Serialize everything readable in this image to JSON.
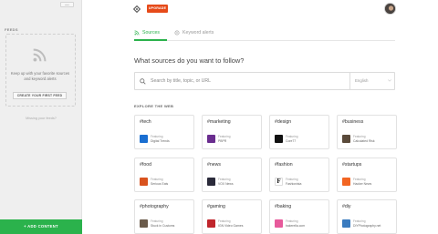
{
  "sidebar": {
    "collapse_label": "«««",
    "feeds_title": "FEEDS",
    "empty_message": "Keep up with your favorite sources and keyword alerts",
    "create_button": "CREATE YOUR FIRST FEED",
    "missing_feeds": "Missing your feeds?",
    "add_content": "+ ADD CONTENT",
    "rss_icon": "rss-icon"
  },
  "topbar": {
    "upgrade_label": "UPGRADE",
    "logo_icon": "feedly-logo-icon",
    "avatar_icon": "user-avatar"
  },
  "tabs": [
    {
      "label": "Sources",
      "icon": "rss-icon",
      "active": true
    },
    {
      "label": "Keyword alerts",
      "icon": "alert-icon",
      "active": false
    }
  ],
  "main": {
    "question": "What sources do you want to follow?",
    "search_placeholder": "Search by title, topic, or URL",
    "language": "English",
    "explore_title": "EXPLORE THE WEB"
  },
  "cards": [
    {
      "tag": "#tech",
      "featuring": "Featuring",
      "source": "Digital Trends",
      "color": "#1a6fd1"
    },
    {
      "tag": "#marketing",
      "featuring": "Featuring",
      "source": "PBPR",
      "color": "#6a2d8f"
    },
    {
      "tag": "#design",
      "featuring": "Featuring",
      "source": "Core77",
      "color": "#111111"
    },
    {
      "tag": "#business",
      "featuring": "Featuring",
      "source": "Calculated Risk",
      "color": "#5a4a3a"
    },
    {
      "tag": "#food",
      "featuring": "Featuring",
      "source": "Serious Eats",
      "color": "#d9531e"
    },
    {
      "tag": "#news",
      "featuring": "Featuring",
      "source": "VOX News",
      "color": "#2a2a3a"
    },
    {
      "tag": "#fashion",
      "featuring": "Featuring",
      "source": "Fashionista",
      "color": "#ffffff"
    },
    {
      "tag": "#startups",
      "featuring": "Featuring",
      "source": "Hacker News",
      "color": "#f26522"
    },
    {
      "tag": "#photography",
      "featuring": "Featuring",
      "source": "Stuck in Customs",
      "color": "#6b5b4b"
    },
    {
      "tag": "#gaming",
      "featuring": "Featuring",
      "source": "IGN Video Games",
      "color": "#c0262c"
    },
    {
      "tag": "#baking",
      "featuring": "Featuring",
      "source": "bakerella.com",
      "color": "#e75a9b"
    },
    {
      "tag": "#diy",
      "featuring": "Featuring",
      "source": "DIYPhotography.net",
      "color": "#3a7bbf"
    }
  ]
}
